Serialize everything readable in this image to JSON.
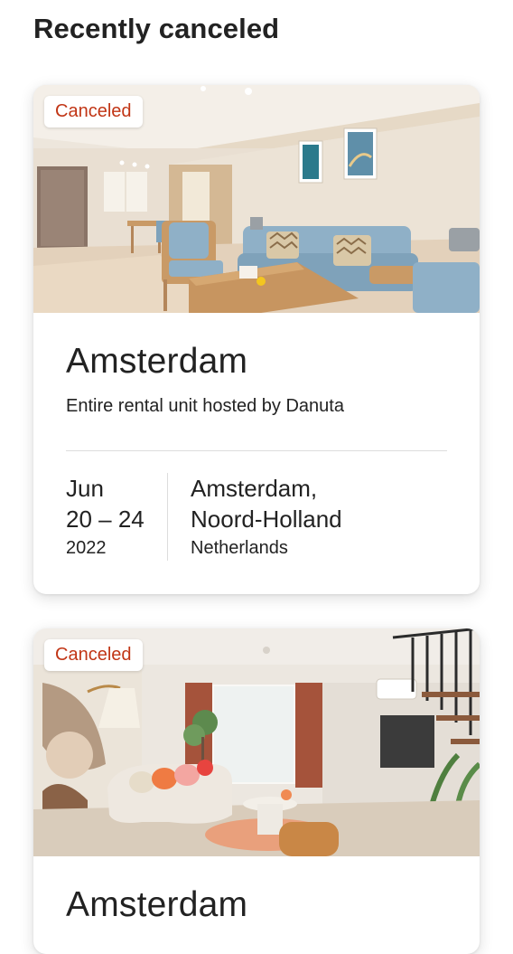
{
  "section": {
    "title": "Recently canceled"
  },
  "trips": [
    {
      "badge": "Canceled",
      "city": "Amsterdam",
      "subtitle": "Entire rental unit hosted by Danuta",
      "dates": {
        "month": "Jun",
        "days": "20 – 24",
        "year": "2022"
      },
      "location": {
        "line1": "Amsterdam,",
        "line2": "Noord-Holland",
        "country": "Netherlands"
      }
    },
    {
      "badge": "Canceled",
      "city": "Amsterdam"
    }
  ],
  "colors": {
    "badge_text": "#c13515",
    "text": "#222222",
    "divider": "#dddddd"
  }
}
